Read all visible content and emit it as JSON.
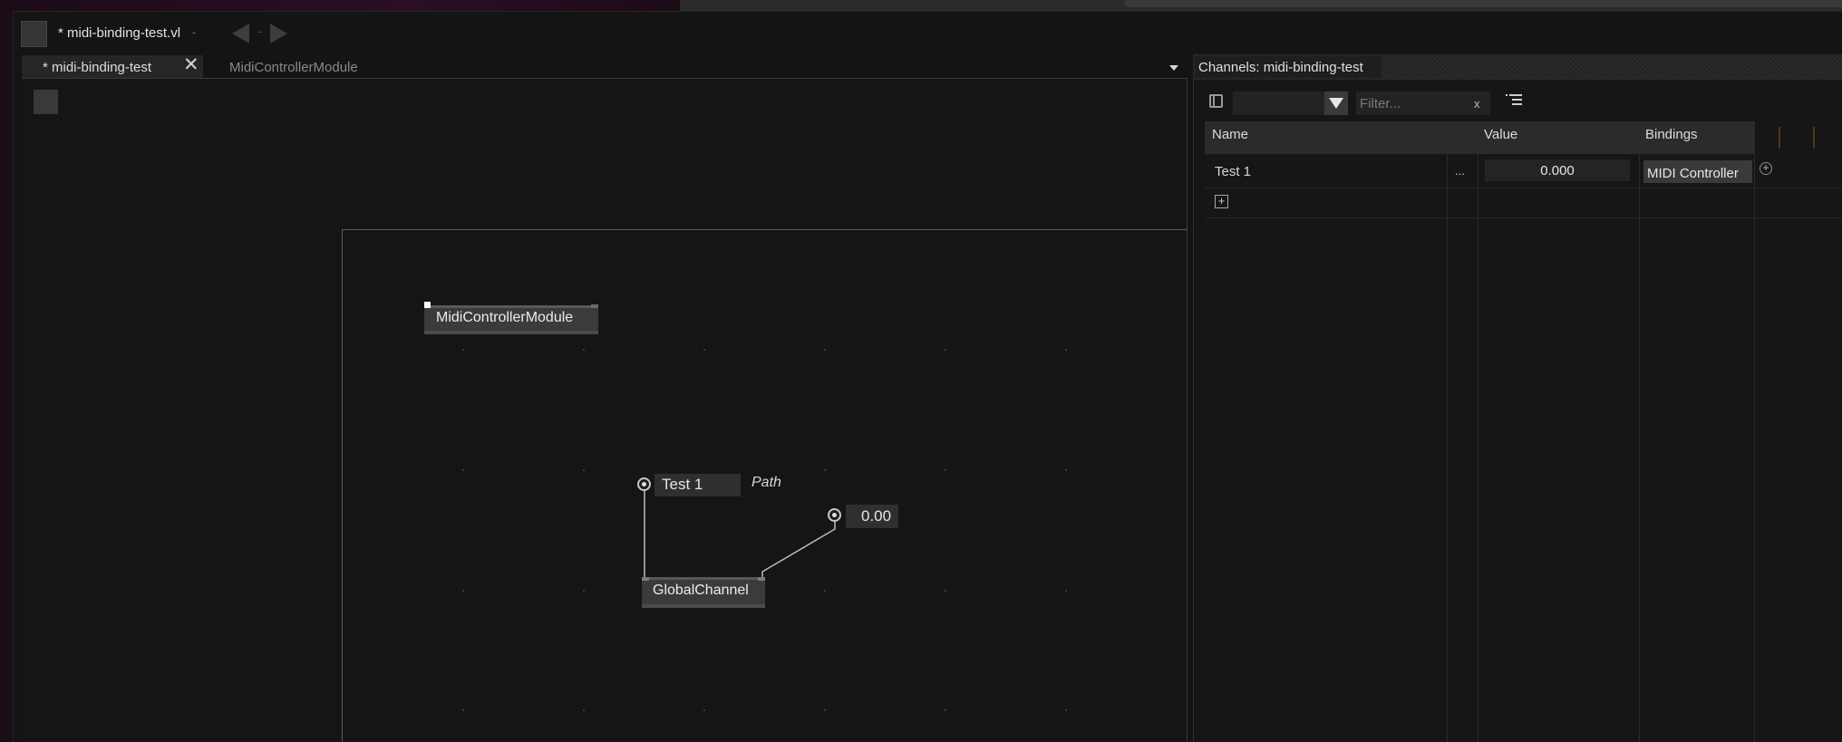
{
  "window": {
    "title": "* midi-binding-test.vl",
    "title_dropdown": "-",
    "nav_separator": "-"
  },
  "tabs": [
    {
      "label": "* midi-binding-test",
      "close": "✕"
    },
    {
      "label": "MidiControllerModule"
    }
  ],
  "patch": {
    "module_node": "MidiControllerModule",
    "channel_path_value": "Test 1",
    "channel_path_label": "Path",
    "channel_value": "0.00",
    "global_channel_node": "GlobalChannel"
  },
  "channels_panel": {
    "title": "Channels: midi-binding-test",
    "filter_placeholder": "Filter...",
    "filter_clear": "x",
    "columns": [
      "Name",
      "Value",
      "Bindings"
    ],
    "rows": [
      {
        "name": "Test 1",
        "edit": "...",
        "value": "0.000",
        "binding": "MIDI Controller",
        "add_binding": "+"
      }
    ],
    "add_channel": "+"
  },
  "icons": {
    "app": "app-icon",
    "nav_back": "back-arrow-icon",
    "nav_forward": "forward-arrow-icon",
    "tab_close": "close-icon",
    "tab_overflow": "chevron-down-icon",
    "panel_toggle": "sidebar-icon",
    "type_dropdown": "chevron-down-icon",
    "list_view": "list-icon",
    "add": "plus-icon"
  },
  "colors": {
    "window_bg": "#141414",
    "node_bg": "#3b3b3b",
    "grid_header_bg": "#2b2b2b",
    "link": "#bdbdbd"
  }
}
